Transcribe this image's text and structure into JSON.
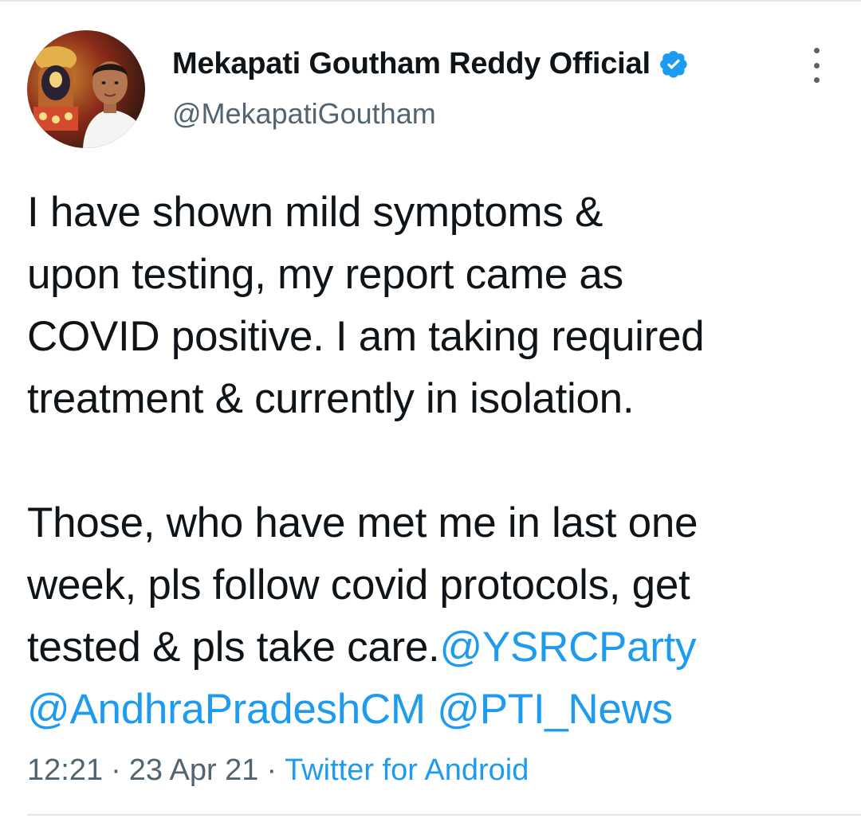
{
  "tweet": {
    "author": {
      "display_name": "Mekapati Goutham Reddy Official",
      "handle": "@MekapatiGoutham",
      "verified": true
    },
    "text_main": "I have shown mild symptoms  &\nupon testing, my report came as\nCOVID positive. I am taking required\ntreatment & currently in isolation.\n\nThose, who have met me in last one\nweek, pls follow covid protocols, get\ntested & pls take care.",
    "mentions": [
      "@YSRCParty",
      "@AndhraPradeshCM",
      "@PTI_News"
    ],
    "time": "12:21",
    "separator": "·",
    "date": "23 Apr 21",
    "source": "Twitter for Android"
  },
  "colors": {
    "text": "#0f1419",
    "secondary": "#536471",
    "link": "#1d9bf0",
    "verified": "#1d9bf0"
  },
  "icons": {
    "verified": "verified-badge-icon",
    "more": "more-vertical-icon"
  }
}
